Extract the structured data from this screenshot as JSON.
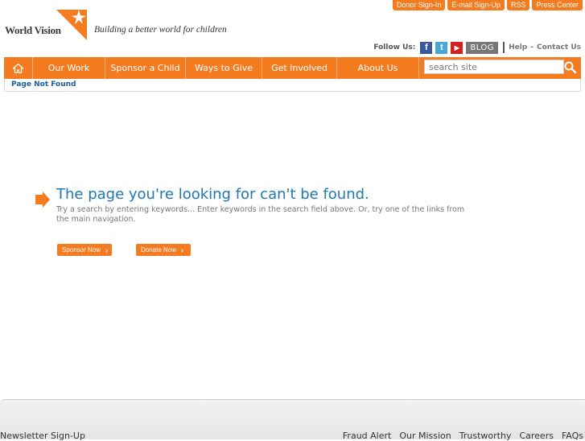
{
  "header": {
    "logo_text": "World Vision",
    "tagline": "Building a better world for children",
    "top_links": [
      "Donor Sign-In",
      "E-mail Sign-Up",
      "RSS",
      "Press Center"
    ],
    "follow_label": "Follow Us:",
    "social": {
      "facebook": "f",
      "twitter": "t",
      "youtube": "▶"
    },
    "blog_label": "BLOG",
    "help_label": "Help",
    "contact_label": "Contact Us",
    "dash": "-"
  },
  "nav": {
    "items": [
      {
        "label": "Our Work"
      },
      {
        "label": "Sponsor a Child"
      },
      {
        "label": "Ways to Give"
      },
      {
        "label": "Get Involved"
      },
      {
        "label": "About Us"
      }
    ],
    "search_placeholder": "search site"
  },
  "breadcrumb": "Page Not Found",
  "main": {
    "heading": "The page you're looking for can't be found.",
    "message": "Try a search by entering keywords... Enter keywords in the search field above. Or, try one of the links from the main navigation.",
    "sponsor_button": "Sponsor Now",
    "donate_button": "Donate Now"
  },
  "footer": {
    "left": "Newsletter Sign-Up",
    "right": [
      "Fraud Alert",
      "Our Mission",
      "Trustworthy",
      "Careers",
      "FAQs"
    ]
  },
  "colors": {
    "accent": "#f47b20",
    "link": "#1f77b4"
  }
}
